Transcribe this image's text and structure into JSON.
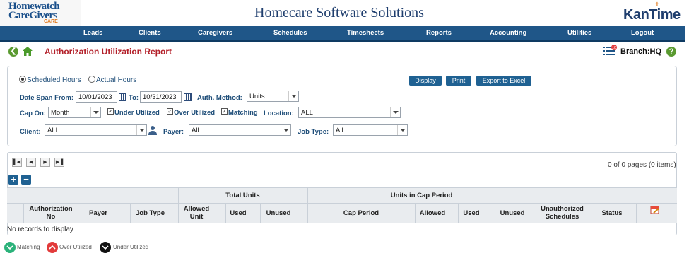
{
  "header": {
    "logo_line1": "Homewatch",
    "logo_line2": "CareGivers",
    "logo_line3": "CARE",
    "app_title": "Homecare Software Solutions",
    "brand": "KanTime"
  },
  "nav": {
    "items": [
      "Leads",
      "Clients",
      "Caregivers",
      "Schedules",
      "Timesheets",
      "Reports",
      "Accounting",
      "Utilities",
      "Logout"
    ]
  },
  "subbar": {
    "page_title": "Authorization Utilization Report",
    "branch": "Branch:HQ",
    "notification_count": "10"
  },
  "filters": {
    "hours": {
      "scheduled": "Scheduled Hours",
      "actual": "Actual Hours"
    },
    "date_span_from_label": "Date Span From:",
    "date_from": "10/01/2023",
    "to_label": "To:",
    "date_to": "10/31/2023",
    "auth_method_label": "Auth. Method:",
    "auth_method": "Units",
    "cap_on_label": "Cap On:",
    "cap_on": "Month",
    "under_utilized": "Under Utilized",
    "over_utilized": "Over Utilized",
    "matching": "Matching",
    "location_label": "Location:",
    "location": "ALL",
    "client_label": "Client:",
    "client": "ALL",
    "payer_label": "Payer:",
    "payer": "All",
    "job_type_label": "Job Type:",
    "job_type": "All",
    "buttons": {
      "display": "Display",
      "print": "Print",
      "export": "Export to Excel"
    }
  },
  "grid": {
    "pager_info": "0 of 0 pages (0 items)",
    "group_headers": {
      "total_units": "Total Units",
      "units_in_cap": "Units in Cap Period"
    },
    "columns": [
      "Authorization No",
      "Payer",
      "Job Type",
      "Allowed Unit",
      "Used",
      "Unused",
      "Cap Period",
      "Allowed",
      "Used",
      "Unused",
      "Unauthorized Schedules",
      "Status"
    ],
    "empty_message": "No records to display"
  },
  "legend": {
    "matching": "Matching",
    "over": "Over Utilized",
    "under": "Under Utilized",
    "colors": {
      "matching": "#2bb27a",
      "over": "#e23b3b",
      "under": "#111111"
    }
  }
}
